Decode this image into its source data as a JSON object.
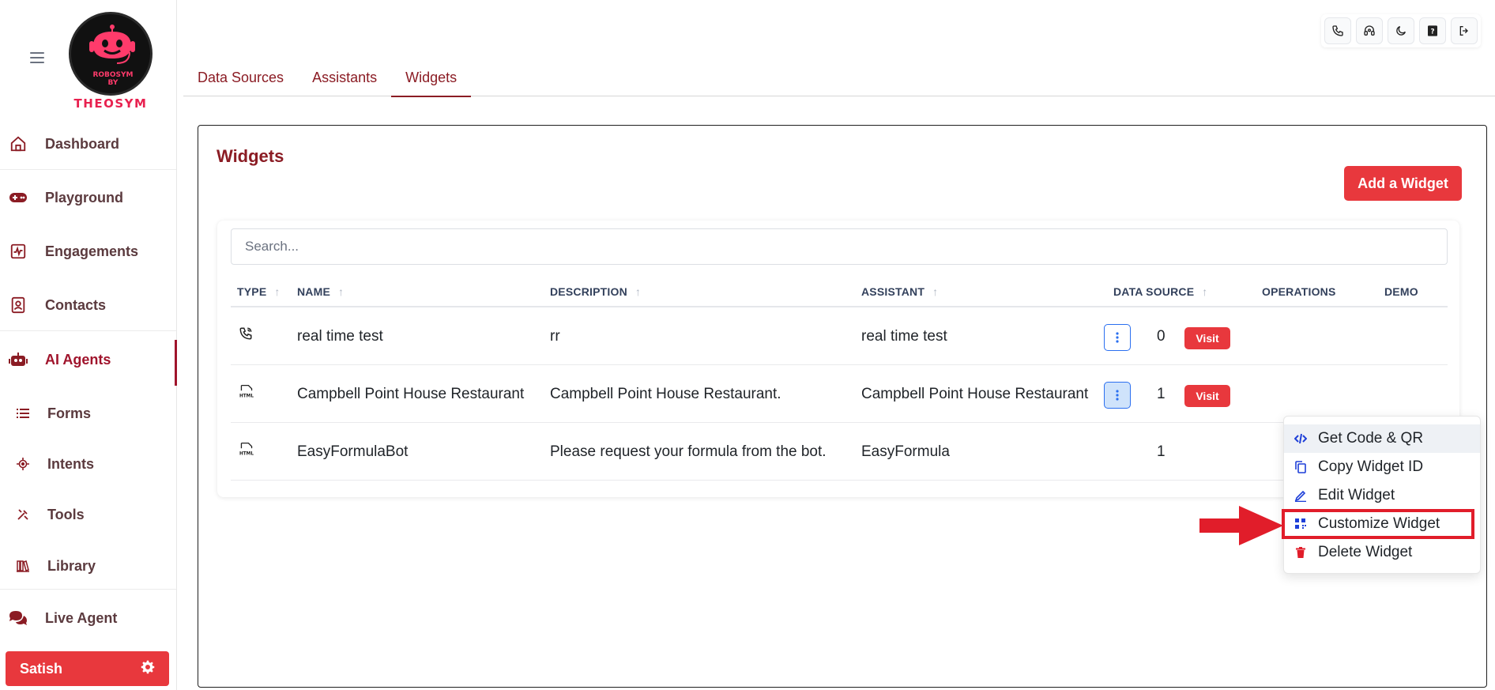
{
  "brand": {
    "logo_sub_lines": [
      "ROBOSYM",
      "BY"
    ],
    "logo_word": "THEOSYM",
    "accent": "#e8383d",
    "accent_dark": "#8b1c24"
  },
  "sidebar": {
    "items": [
      {
        "label": "Dashboard",
        "icon": "home-icon"
      },
      {
        "label": "Playground",
        "icon": "gamepad-icon"
      },
      {
        "label": "Engagements",
        "icon": "activity-icon"
      },
      {
        "label": "Contacts",
        "icon": "contact-card-icon"
      },
      {
        "label": "AI Agents",
        "icon": "robot-icon",
        "active": true
      },
      {
        "label": "Forms",
        "icon": "list-icon"
      },
      {
        "label": "Intents",
        "icon": "crosshair-icon"
      },
      {
        "label": "Tools",
        "icon": "tools-icon"
      },
      {
        "label": "Library",
        "icon": "library-icon"
      },
      {
        "label": "Live Agent",
        "icon": "chat-bubbles-icon"
      }
    ],
    "user": {
      "name": "Satish"
    }
  },
  "top_tools": [
    "phone-icon",
    "headset-icon",
    "moon-icon",
    "help-icon",
    "logout-icon"
  ],
  "tabs": [
    {
      "label": "Data Sources",
      "active": false
    },
    {
      "label": "Assistants",
      "active": false
    },
    {
      "label": "Widgets",
      "active": true
    }
  ],
  "page": {
    "title": "Widgets",
    "add_button": "Add a Widget",
    "search_placeholder": "Search..."
  },
  "table": {
    "headers": {
      "type": "TYPE",
      "name": "NAME",
      "description": "DESCRIPTION",
      "assistant": "ASSISTANT",
      "data_source": "DATA SOURCE",
      "operations": "OPERATIONS",
      "demo": "DEMO"
    },
    "rows": [
      {
        "type_icon": "phone-call-icon",
        "name": "real time test",
        "description": "rr",
        "assistant": "real time test",
        "data_source": "0",
        "visit": "Visit"
      },
      {
        "type_icon": "html-file-icon",
        "name": "Campbell Point House Restaurant",
        "description": "Campbell Point House Restaurant.",
        "assistant": "Campbell Point House Restaurant",
        "data_source": "1",
        "visit": "Visit"
      },
      {
        "type_icon": "html-file-icon",
        "name": "EasyFormulaBot",
        "description": "Please request your formula from the bot.",
        "assistant": "EasyFormula",
        "data_source": "1",
        "visit": ""
      }
    ]
  },
  "operations_menu": {
    "items": [
      {
        "label": "Get Code & QR",
        "icon": "code-icon"
      },
      {
        "label": "Copy Widget ID",
        "icon": "copy-icon"
      },
      {
        "label": "Edit Widget",
        "icon": "pencil-icon"
      },
      {
        "label": "Customize Widget",
        "icon": "widget-grid-icon"
      },
      {
        "label": "Delete Widget",
        "icon": "trash-icon"
      }
    ]
  }
}
